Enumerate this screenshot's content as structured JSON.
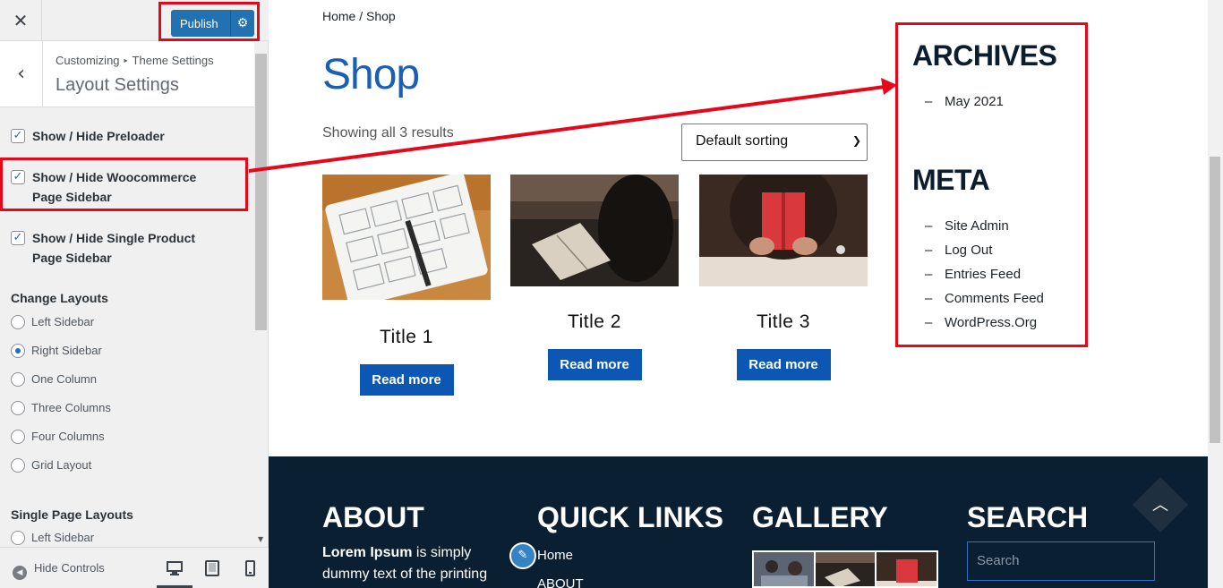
{
  "customizer": {
    "close_icon": "close-icon",
    "publish_label": "Publish",
    "breadcrumb": {
      "root": "Customizing",
      "parent": "Theme Settings"
    },
    "section_title": "Layout Settings",
    "checkboxes": [
      {
        "label": "Show / Hide Preloader",
        "checked": true
      },
      {
        "label": "Show / Hide Woocommerce Page Sidebar",
        "checked": true
      },
      {
        "label": "Show / Hide Single Product Page Sidebar",
        "checked": true
      }
    ],
    "change_layouts": {
      "title": "Change Layouts",
      "options": [
        "Left Sidebar",
        "Right Sidebar",
        "One Column",
        "Three Columns",
        "Four Columns",
        "Grid Layout"
      ],
      "selected": "Right Sidebar"
    },
    "single_page_layouts": {
      "title": "Single Page Layouts",
      "options": [
        "Left Sidebar"
      ]
    },
    "footer": {
      "hide_controls_label": "Hide Controls",
      "devices": [
        "desktop-icon",
        "tablet-icon",
        "mobile-icon"
      ],
      "active_device": "desktop"
    }
  },
  "preview": {
    "breadcrumb": "Home / Shop",
    "page_title": "Shop",
    "result_count": "Showing all 3 results",
    "sorting": {
      "selected": "Default sorting"
    },
    "products": [
      {
        "title": "Title 1",
        "button": "Read more"
      },
      {
        "title": "Title 2",
        "button": "Read more"
      },
      {
        "title": "Title 3",
        "button": "Read more"
      }
    ],
    "sidebar": {
      "archives_title": "ARCHIVES",
      "archives": [
        "May 2021"
      ],
      "meta_title": "META",
      "meta": [
        "Site Admin",
        "Log Out",
        "Entries Feed",
        "Comments Feed",
        "WordPress.Org"
      ]
    },
    "footer": {
      "about_title": "ABOUT",
      "about_bold": "Lorem Ipsum",
      "about_text": " is simply dummy text of the printing",
      "quick_links_title": "QUICK LINKS",
      "quick_links": [
        "Home",
        "ABOUT"
      ],
      "gallery_title": "GALLERY",
      "search_title": "SEARCH",
      "search_placeholder": "Search"
    }
  },
  "colors": {
    "accent": "#2271b1",
    "highlight": "#e5081a",
    "footer_bg": "#0a1f31",
    "link_blue": "#0b57b3"
  }
}
